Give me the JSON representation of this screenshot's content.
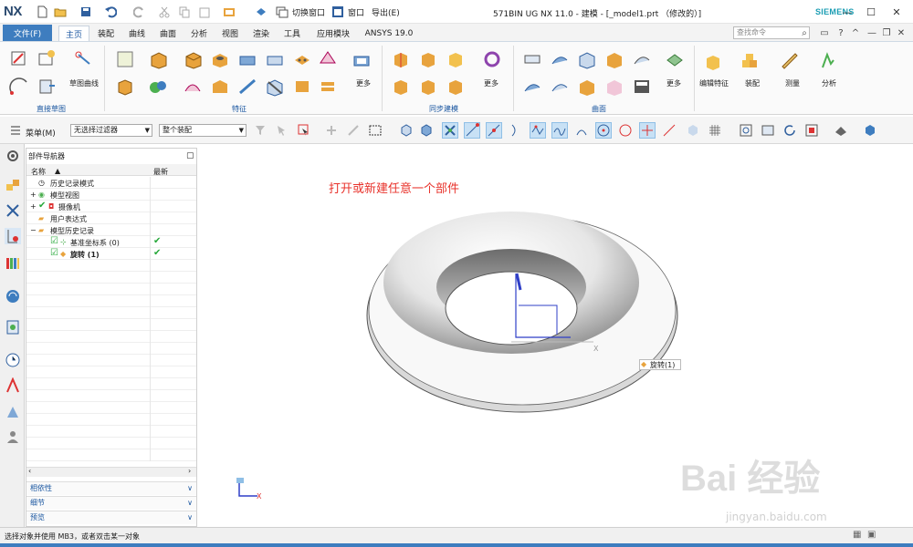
{
  "app": {
    "logo": "NX",
    "window_title": "571BIN UG NX 11.0 - 建模 - [_model1.prt （修改的）]",
    "brand": "SIEMENS"
  },
  "quick_access": {
    "switch_window": "切换窗口",
    "window": "窗口",
    "export": "导出(E)"
  },
  "menu": {
    "file": "文件(F)",
    "tabs": [
      "主页",
      "装配",
      "曲线",
      "曲面",
      "分析",
      "视图",
      "渲染",
      "工具",
      "应用模块",
      "ANSYS 19.0"
    ],
    "active_tab": "主页",
    "search_placeholder": "查找命令"
  },
  "ribbon": {
    "groups": [
      "直接草图",
      "特征",
      "同步建模",
      "曲面"
    ],
    "labels": {
      "sketch_curve": "草图曲线",
      "more1": "更多",
      "more2": "更多",
      "more3": "更多",
      "edit_feature": "编辑特征",
      "assembly": "装配",
      "measure": "测量",
      "analysis": "分析"
    }
  },
  "filterbar": {
    "menu": "菜单(M)",
    "filter": "无选择过滤器",
    "scope": "整个装配"
  },
  "navigator": {
    "title": "部件导航器",
    "col_name": "名称",
    "col_latest": "最新",
    "rows": [
      {
        "label": "历史记录模式"
      },
      {
        "label": "模型视图"
      },
      {
        "label": "摄像机"
      },
      {
        "label": "用户表达式"
      },
      {
        "label": "模型历史记录"
      },
      {
        "label": "基准坐标系 (0)"
      },
      {
        "label": "旋转 (1)"
      }
    ],
    "panels": [
      "相依性",
      "细节",
      "预览"
    ]
  },
  "canvas": {
    "hint": "打开或新建任意一个部件",
    "feature_tag": "旋转(1)",
    "axis_x": "X"
  },
  "status": {
    "text": "选择对象并使用 MB3，或者双击某一对象"
  },
  "watermark": {
    "main": "Bai 经验",
    "sub": "jingyan.baidu.com"
  },
  "colors": {
    "accent": "#3e7dbf",
    "hint": "#e8322b",
    "brand": "#1b9db3"
  }
}
